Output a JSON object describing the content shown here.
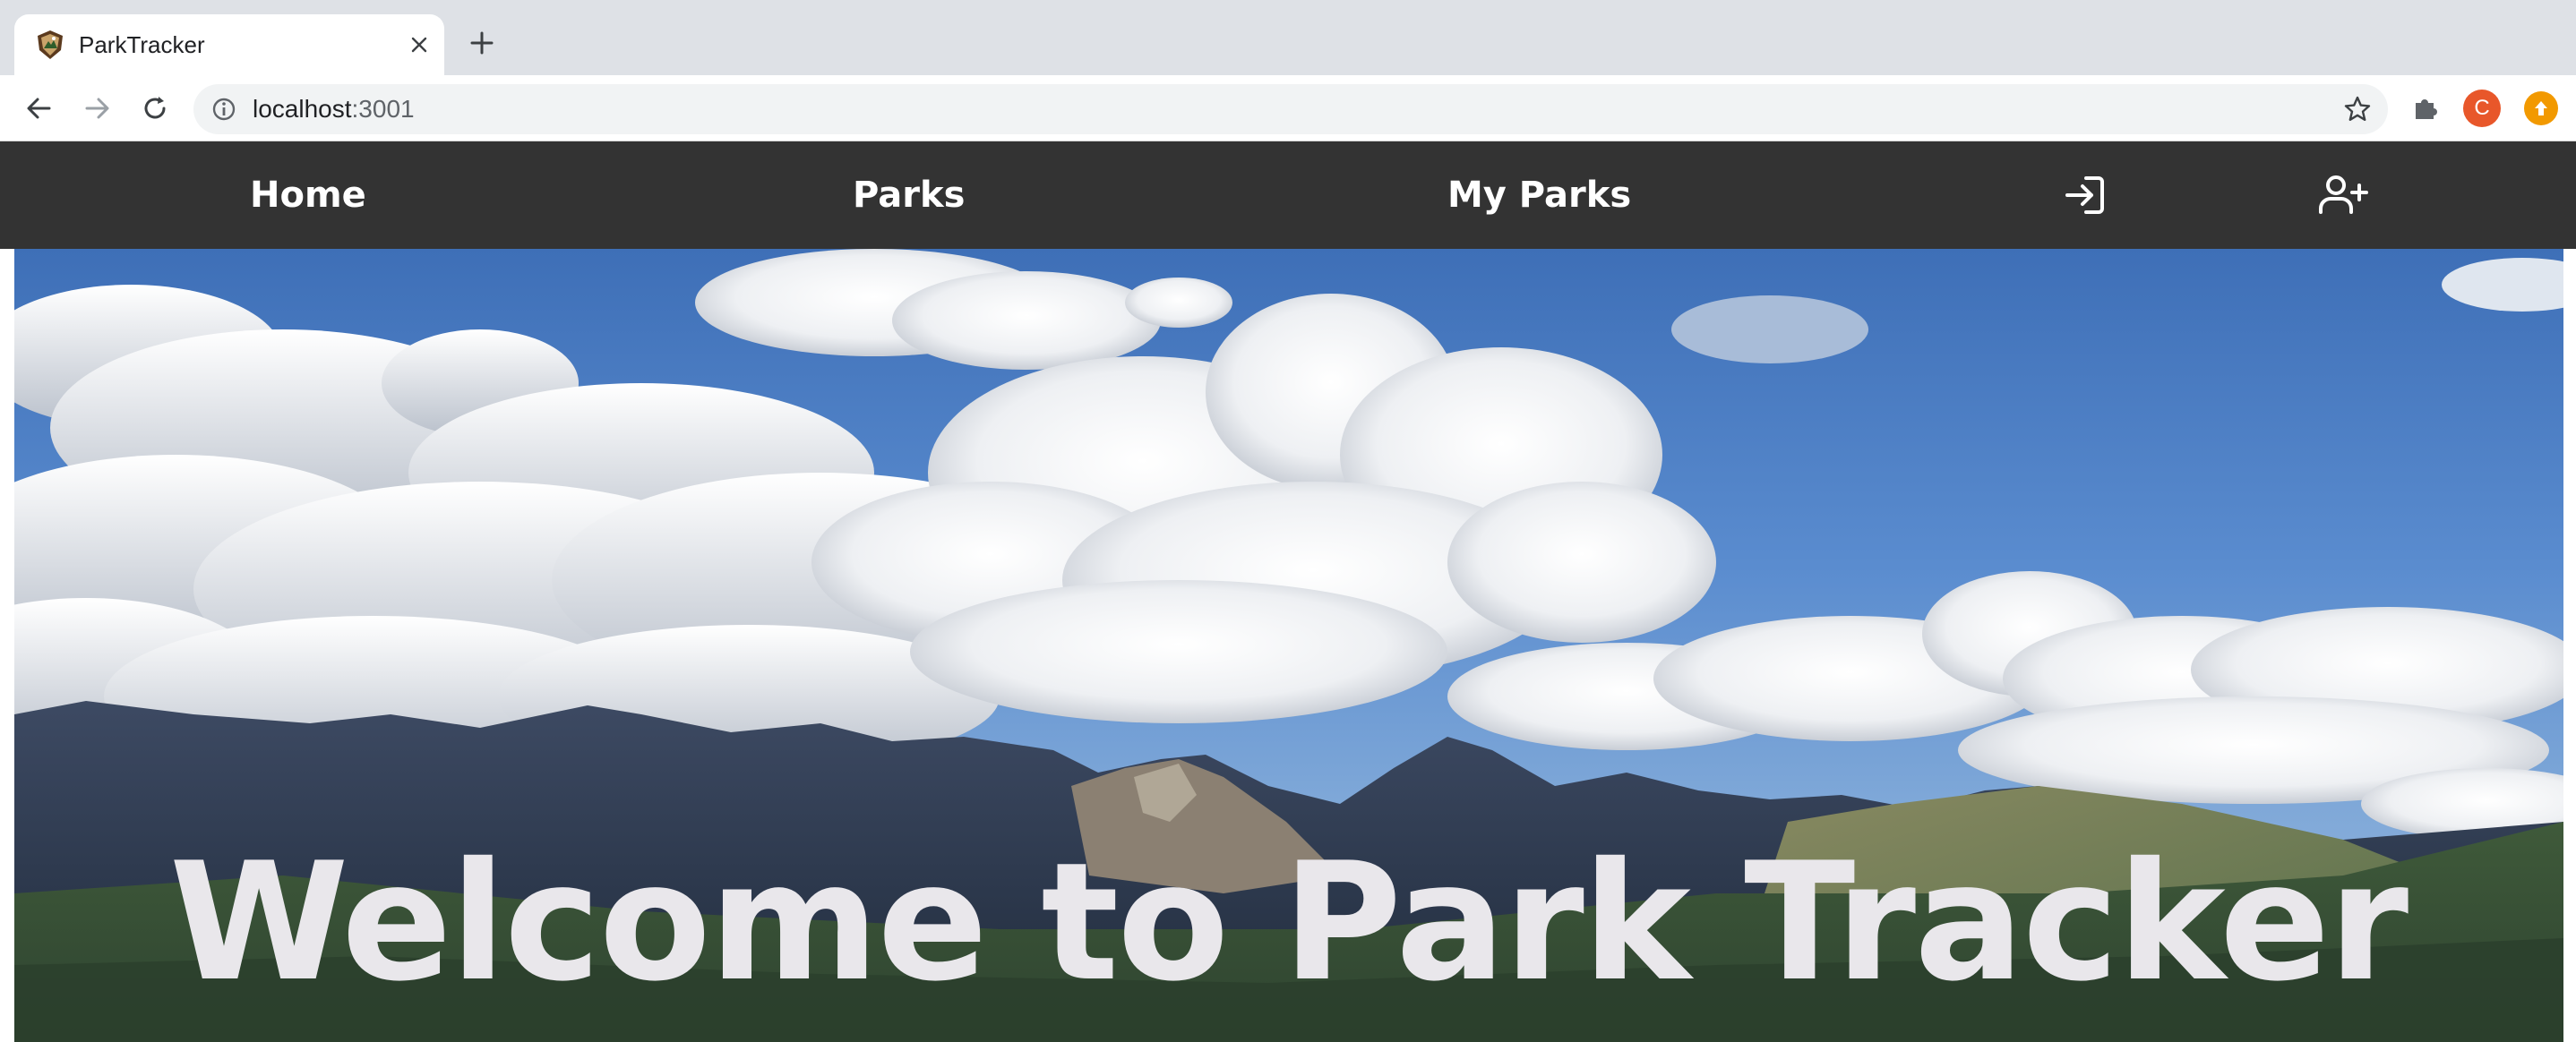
{
  "browser": {
    "tab": {
      "title": "ParkTracker"
    },
    "address_bar": {
      "host": "localhost",
      "port": ":3001"
    },
    "profile_initial": "C"
  },
  "nav": {
    "items": [
      {
        "label": "Home"
      },
      {
        "label": "Parks"
      },
      {
        "label": "My Parks"
      }
    ],
    "login_icon": "sign-in-icon",
    "signup_icon": "user-plus-icon"
  },
  "hero": {
    "title": "Welcome to Park Tracker"
  },
  "colors": {
    "nav_background": "#333333",
    "hero_title": "#e9e7eb",
    "avatar": "#e8572a",
    "update": "#f29900"
  }
}
